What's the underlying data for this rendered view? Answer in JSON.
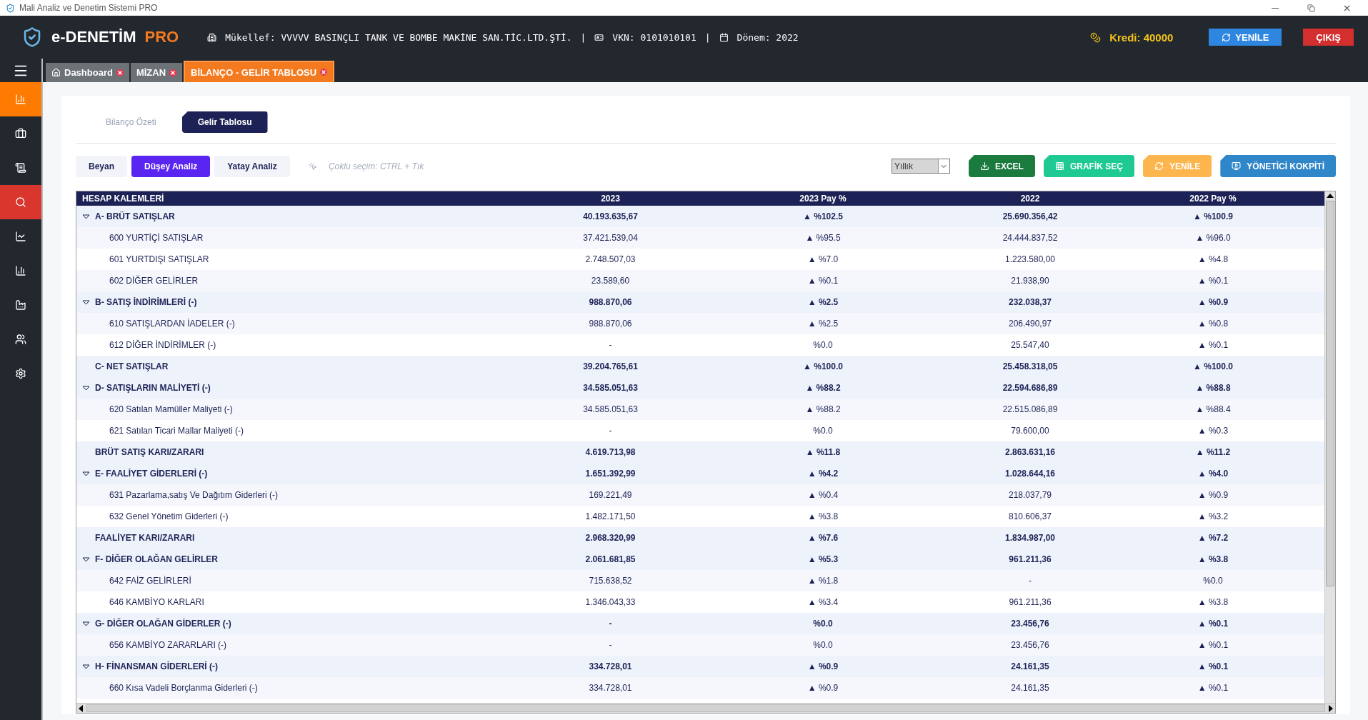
{
  "window": {
    "title": "Mali Analiz ve Denetim Sistemi PRO"
  },
  "header": {
    "brand": "e-DENETİM",
    "edition": "PRO",
    "taxpayer": "Mükellef: VVVVV BASINÇLI TANK VE BOMBE MAKİNE SAN.TİC.LTD.ŞTİ.",
    "separators": [
      "|",
      "|"
    ],
    "tax_id": "VKN: 0101010101",
    "period": "Dönem: 2022",
    "credit": "Kredi: 40000",
    "refresh": "YENİLE",
    "logout": "ÇIKIŞ"
  },
  "sidebar": {
    "items": [
      {
        "selected": true,
        "highlighted": false
      },
      {
        "selected": false,
        "highlighted": false
      },
      {
        "selected": false,
        "highlighted": false
      },
      {
        "selected": false,
        "highlighted": true
      },
      {
        "selected": false,
        "highlighted": false
      },
      {
        "selected": false,
        "highlighted": false
      },
      {
        "selected": false,
        "highlighted": false
      },
      {
        "selected": false,
        "highlighted": false
      },
      {
        "selected": false,
        "highlighted": false
      }
    ]
  },
  "tabs": [
    {
      "label": "Dashboard",
      "selected": false
    },
    {
      "label": "MİZAN",
      "selected": false
    },
    {
      "label": "BİLANÇO - GELİR TABLOSU",
      "selected": true
    }
  ],
  "subtabs": [
    {
      "label": "Bilanço Özeti",
      "selected": false
    },
    {
      "label": "Gelir Tablosu",
      "selected": true
    }
  ],
  "analysis_tabs": [
    {
      "label": "Beyan",
      "selected": false
    },
    {
      "label": "Düşey Analiz",
      "selected": true
    },
    {
      "label": "Yatay Analiz",
      "selected": false
    }
  ],
  "hint": "Çoklu seçim: CTRL + Tık",
  "period_select": {
    "value": "Yıllık"
  },
  "actions": [
    {
      "label": "EXCEL",
      "color": "#1b7a3e"
    },
    {
      "label": "GRAFİK SEÇ",
      "color": "#1fc993"
    },
    {
      "label": "YENİLE",
      "color": "#fdb54e"
    },
    {
      "label": "YÖNETİCİ KOKPİTİ",
      "color": "#2f86c9"
    }
  ],
  "table": {
    "columns": [
      "HESAP KALEMLERİ",
      "2023",
      "2023 Pay %",
      "2022",
      "2022 Pay %"
    ],
    "rows": [
      {
        "kind": "group",
        "expanded": true,
        "cells": [
          "A- BRÜT SATIŞLAR",
          "40.193.635,67",
          "▲ %102.5",
          "25.690.356,42",
          "▲ %100.9"
        ],
        "children": [
          {
            "cells": [
              "600 YURTİÇİ SATIŞLAR",
              "37.421.539,04",
              "▲ %95.5",
              "24.444.837,52",
              "▲ %96.0"
            ]
          },
          {
            "cells": [
              "601 YURTDIŞI SATIŞLAR",
              "2.748.507,03",
              "▲ %7.0",
              "1.223.580,00",
              "▲ %4.8"
            ]
          },
          {
            "cells": [
              "602 DİĞER GELİRLER",
              "23.589,60",
              "▲ %0.1",
              "21.938,90",
              "▲ %0.1"
            ]
          }
        ]
      },
      {
        "kind": "group",
        "expanded": true,
        "cells": [
          "B- SATIŞ İNDİRİMLERİ (-)",
          "988.870,06",
          "▲ %2.5",
          "232.038,37",
          "▲ %0.9"
        ],
        "children": [
          {
            "cells": [
              "610 SATIŞLARDAN İADELER (-)",
              "988.870,06",
              "▲ %2.5",
              "206.490,97",
              "▲ %0.8"
            ]
          },
          {
            "cells": [
              "612 DİĞER İNDİRİMLER (-)",
              "-",
              "%0.0",
              "25.547,40",
              "▲ %0.1"
            ]
          }
        ]
      },
      {
        "kind": "total",
        "cells": [
          "C- NET SATIŞLAR",
          "39.204.765,61",
          "▲ %100.0",
          "25.458.318,05",
          "▲ %100.0"
        ]
      },
      {
        "kind": "group",
        "expanded": true,
        "cells": [
          "D- SATIŞLARIN MALİYETİ (-)",
          "34.585.051,63",
          "▲ %88.2",
          "22.594.686,89",
          "▲ %88.8"
        ],
        "children": [
          {
            "cells": [
              "620 Satılan Mamüller Maliyeti (-)",
              "34.585.051,63",
              "▲ %88.2",
              "22.515.086,89",
              "▲ %88.4"
            ]
          },
          {
            "cells": [
              "621 Satılan Ticari Mallar Maliyeti (-)",
              "-",
              "%0.0",
              "79.600,00",
              "▲ %0.3"
            ]
          }
        ]
      },
      {
        "kind": "total",
        "cells": [
          "BRÜT SATIŞ KARI/ZARARI",
          "4.619.713,98",
          "▲ %11.8",
          "2.863.631,16",
          "▲ %11.2"
        ]
      },
      {
        "kind": "group",
        "expanded": true,
        "cells": [
          "E- FAALİYET GİDERLERİ (-)",
          "1.651.392,99",
          "▲ %4.2",
          "1.028.644,16",
          "▲ %4.0"
        ],
        "children": [
          {
            "cells": [
              "631 Pazarlama,satış Ve Dağıtım Giderleri (-)",
              "169.221,49",
              "▲ %0.4",
              "218.037,79",
              "▲ %0.9"
            ]
          },
          {
            "cells": [
              "632 Genel Yönetim Giderleri (-)",
              "1.482.171,50",
              "▲ %3.8",
              "810.606,37",
              "▲ %3.2"
            ]
          }
        ]
      },
      {
        "kind": "total",
        "cells": [
          "FAALİYET KARI/ZARARI",
          "2.968.320,99",
          "▲ %7.6",
          "1.834.987,00",
          "▲ %7.2"
        ]
      },
      {
        "kind": "group",
        "expanded": true,
        "cells": [
          "F- DİĞER OLAĞAN GELİRLER",
          "2.061.681,85",
          "▲ %5.3",
          "961.211,36",
          "▲ %3.8"
        ],
        "children": [
          {
            "cells": [
              "642 FAİZ GELİRLERİ",
              "715.638,52",
              "▲ %1.8",
              "-",
              "%0.0"
            ]
          },
          {
            "cells": [
              "646 KAMBİYO KARLARI",
              "1.346.043,33",
              "▲ %3.4",
              "961.211,36",
              "▲ %3.8"
            ]
          }
        ]
      },
      {
        "kind": "group",
        "expanded": true,
        "cells": [
          "G- DİĞER OLAĞAN GİDERLER (-)",
          "-",
          "%0.0",
          "23.456,76",
          "▲ %0.1"
        ],
        "children": [
          {
            "cells": [
              "656 KAMBİYO ZARARLARI (-)",
              "-",
              "%0.0",
              "23.456,76",
              "▲ %0.1"
            ]
          }
        ]
      },
      {
        "kind": "group",
        "expanded": true,
        "cells": [
          "H- FİNANSMAN GİDERLERİ (-)",
          "334.728,01",
          "▲ %0.9",
          "24.161,35",
          "▲ %0.1"
        ],
        "children": [
          {
            "cells": [
              "660 Kısa Vadeli Borçlanma Giderleri (-)",
              "334.728,01",
              "▲ %0.9",
              "24.161,35",
              "▲ %0.1"
            ]
          }
        ]
      }
    ]
  }
}
